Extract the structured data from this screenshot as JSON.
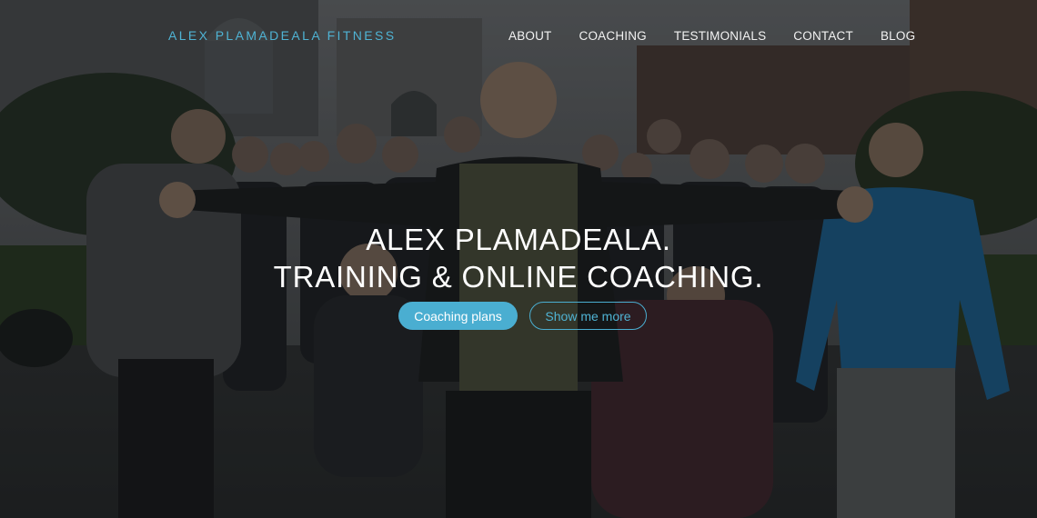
{
  "nav": {
    "brand": "ALEX PLAMADEALA FITNESS",
    "items": [
      {
        "label": "ABOUT"
      },
      {
        "label": "COACHING"
      },
      {
        "label": "TESTIMONIALS"
      },
      {
        "label": "CONTACT"
      },
      {
        "label": "BLOG"
      }
    ]
  },
  "hero": {
    "headline_line1": "ALEX PLAMADEALA.",
    "headline_line2": "TRAINING & ONLINE COACHING.",
    "primary_cta": "Coaching plans",
    "secondary_cta": "Show me more"
  },
  "colors": {
    "accent": "#4aaed1",
    "text": "#ffffff",
    "overlay": "#0a0c0e"
  }
}
